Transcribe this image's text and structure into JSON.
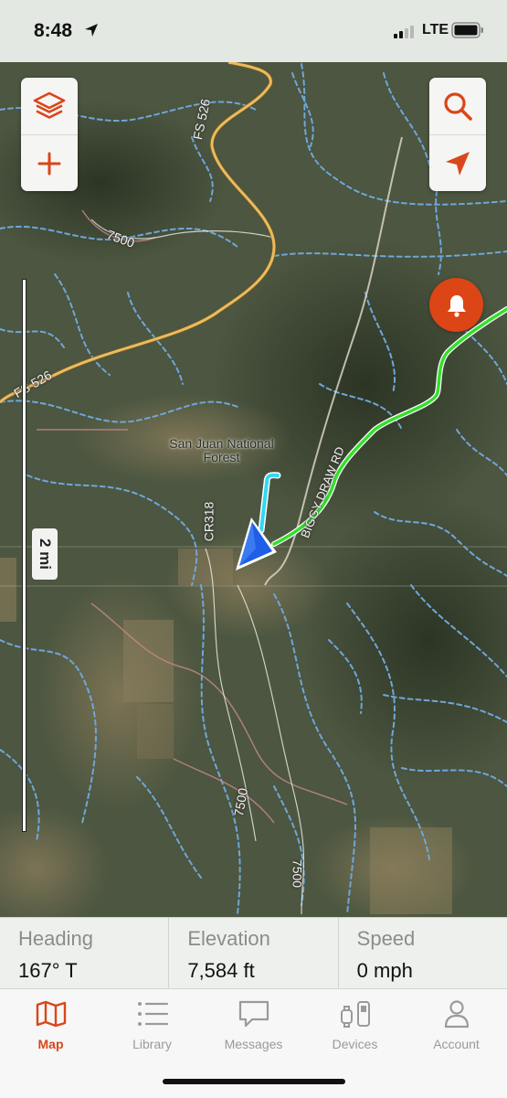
{
  "status_bar": {
    "time": "8:48",
    "network": "LTE"
  },
  "map": {
    "labels": {
      "fs526_top": "FS 526",
      "fs526_left": "FS 526",
      "road_7500_top": "7500",
      "forest_name": "San Juan National Forest",
      "cr318": "CR318",
      "piggy_draw": "BIGGY DRAW RD",
      "road_7500_mid": "7500",
      "road_7500_bottom": "7500"
    },
    "controls": {
      "layers_icon": "layers-icon",
      "add_icon": "plus-icon",
      "search_icon": "search-icon",
      "locate_icon": "location-arrow-icon",
      "alert_icon": "bell-icon"
    },
    "scale": "2 mi",
    "colors": {
      "track": "#31e02a",
      "heading_line": "#2fd6f0",
      "position_marker": "#1f5ee8",
      "accent": "#dc4515",
      "road": "#e9b55a"
    }
  },
  "stats": {
    "heading_label": "Heading",
    "heading_value": "167° T",
    "elevation_label": "Elevation",
    "elevation_value": "7,584 ft",
    "speed_label": "Speed",
    "speed_value": "0 mph"
  },
  "tabs": [
    {
      "label": "Map",
      "icon": "map-icon",
      "active": true
    },
    {
      "label": "Library",
      "icon": "list-icon",
      "active": false
    },
    {
      "label": "Messages",
      "icon": "message-icon",
      "active": false
    },
    {
      "label": "Devices",
      "icon": "devices-icon",
      "active": false
    },
    {
      "label": "Account",
      "icon": "person-icon",
      "active": false
    }
  ]
}
